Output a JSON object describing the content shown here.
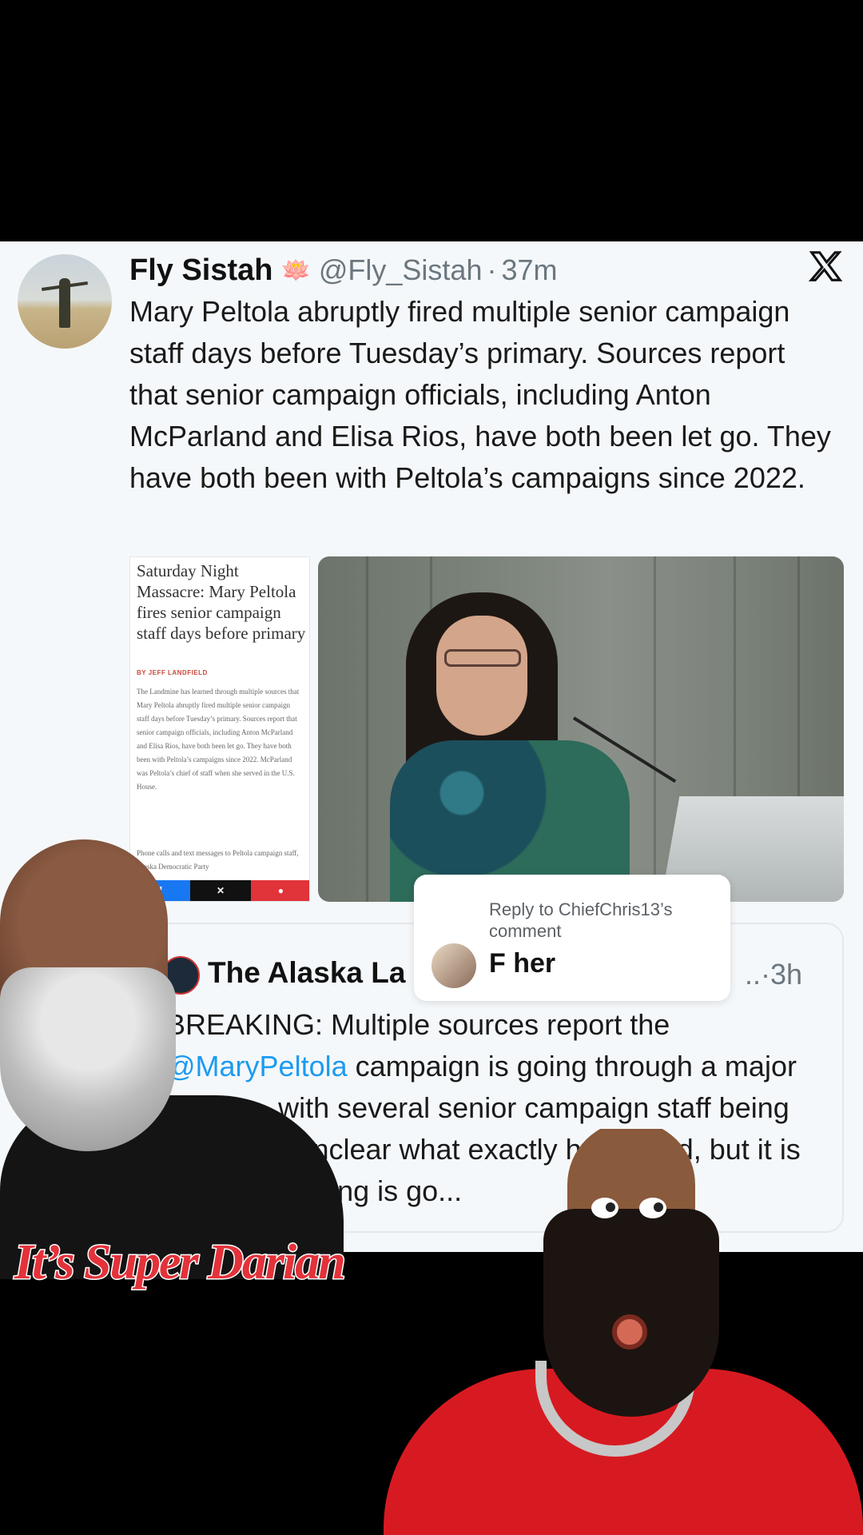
{
  "tweet": {
    "author_name": "Fly Sistah",
    "author_emoji": "🪷",
    "handle": "@Fly_Sistah",
    "separator": "·",
    "time": "37m",
    "text": "Mary Peltola abruptly fired multiple senior campaign staff days before Tuesday’s primary. Sources report that senior campaign officials, including Anton McParland and Elisa Rios, have both been let go. They have both been with Peltola’s campaigns since 2022.",
    "article": {
      "headline": "Saturday Night Massacre: Mary Peltola fires senior campaign staff days before primary",
      "byline": "BY JEFF LANDFIELD",
      "body": "The Landmine has learned through multiple sources that Mary Peltola abruptly fired multiple senior campaign staff days before Tuesday’s primary. Sources report that senior campaign officials, including Anton McParland and Elisa Rios, have both been let go. They have both been with Peltola’s campaigns since 2022. McParland was Peltola’s chief of staff when she served in the U.S. House.",
      "body_2": "Phone calls and text messages to Peltola campaign staff, Alaska Democratic Party"
    }
  },
  "quote": {
    "name": "The Alaska La",
    "time": "3h",
    "text_before": "BREAKING: Multiple sources report the ",
    "mention": "@MaryPeltola",
    "text_after": " campaign is going through a major dust-up, with several senior campaign staff being let go. It’s unclear what exactly happened, but it is clear something is go..."
  },
  "reply_overlay": {
    "label": "Reply to ChiefChris13’s comment",
    "text": "F her"
  },
  "watermark": "It’s Super Darian",
  "colors": {
    "link": "#1d9bf0",
    "watermark": "#e4323a",
    "background": "#000000",
    "card": "#f5f8fa"
  }
}
